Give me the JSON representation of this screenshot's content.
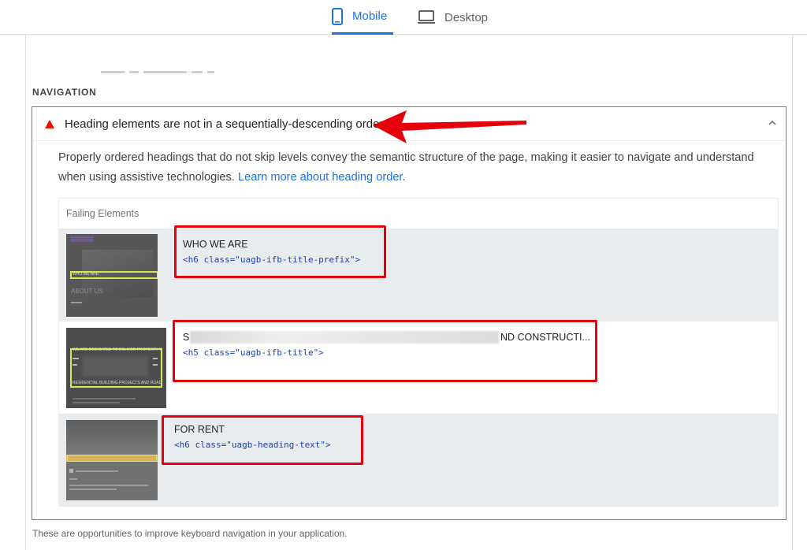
{
  "tabs": [
    {
      "label": "Mobile",
      "icon": "smartphone-icon",
      "active": true
    },
    {
      "label": "Desktop",
      "icon": "monitor-icon",
      "active": false
    }
  ],
  "section": {
    "title": "NAVIGATION",
    "footer": "These are opportunities to improve keyboard navigation in your application."
  },
  "audit": {
    "status_icon": "warning-triangle-icon",
    "status_color": "#eb0f00",
    "title": "Heading elements are not in a sequentially-descending order",
    "description": "Properly ordered headings that do not skip levels convey the semantic structure of the page, making it easier to navigate and understand when using assistive technologies.",
    "learn_more": "Learn more about heading order",
    "description_end": "."
  },
  "failing": {
    "header": "Failing Elements",
    "rows": [
      {
        "text": "WHO WE ARE",
        "code": "<h6 class=\"uagb-ifb-title-prefix\">",
        "thumb_heading": "WHO WE ARE",
        "thumb_caption": "ABOUT US"
      },
      {
        "text_start": "S",
        "text_end": "ND CONSTRUCTI...",
        "code": "<h5 class=\"uagb-ifb-title\">",
        "thumb_line1": "WE ARE DEDICATED TO DELIVER PROPERTY SERVICES",
        "thumb_line2": "RESIDENTIAL BUILDING PROJECTS AND ROAD DEVELOPMENT."
      },
      {
        "text": "FOR RENT",
        "code": "<h6 class=\"uagb-heading-text\">"
      }
    ]
  },
  "colors": {
    "accent": "#1a73e8",
    "annotation": "#e5000b",
    "row_alt": "#e9ecef"
  }
}
